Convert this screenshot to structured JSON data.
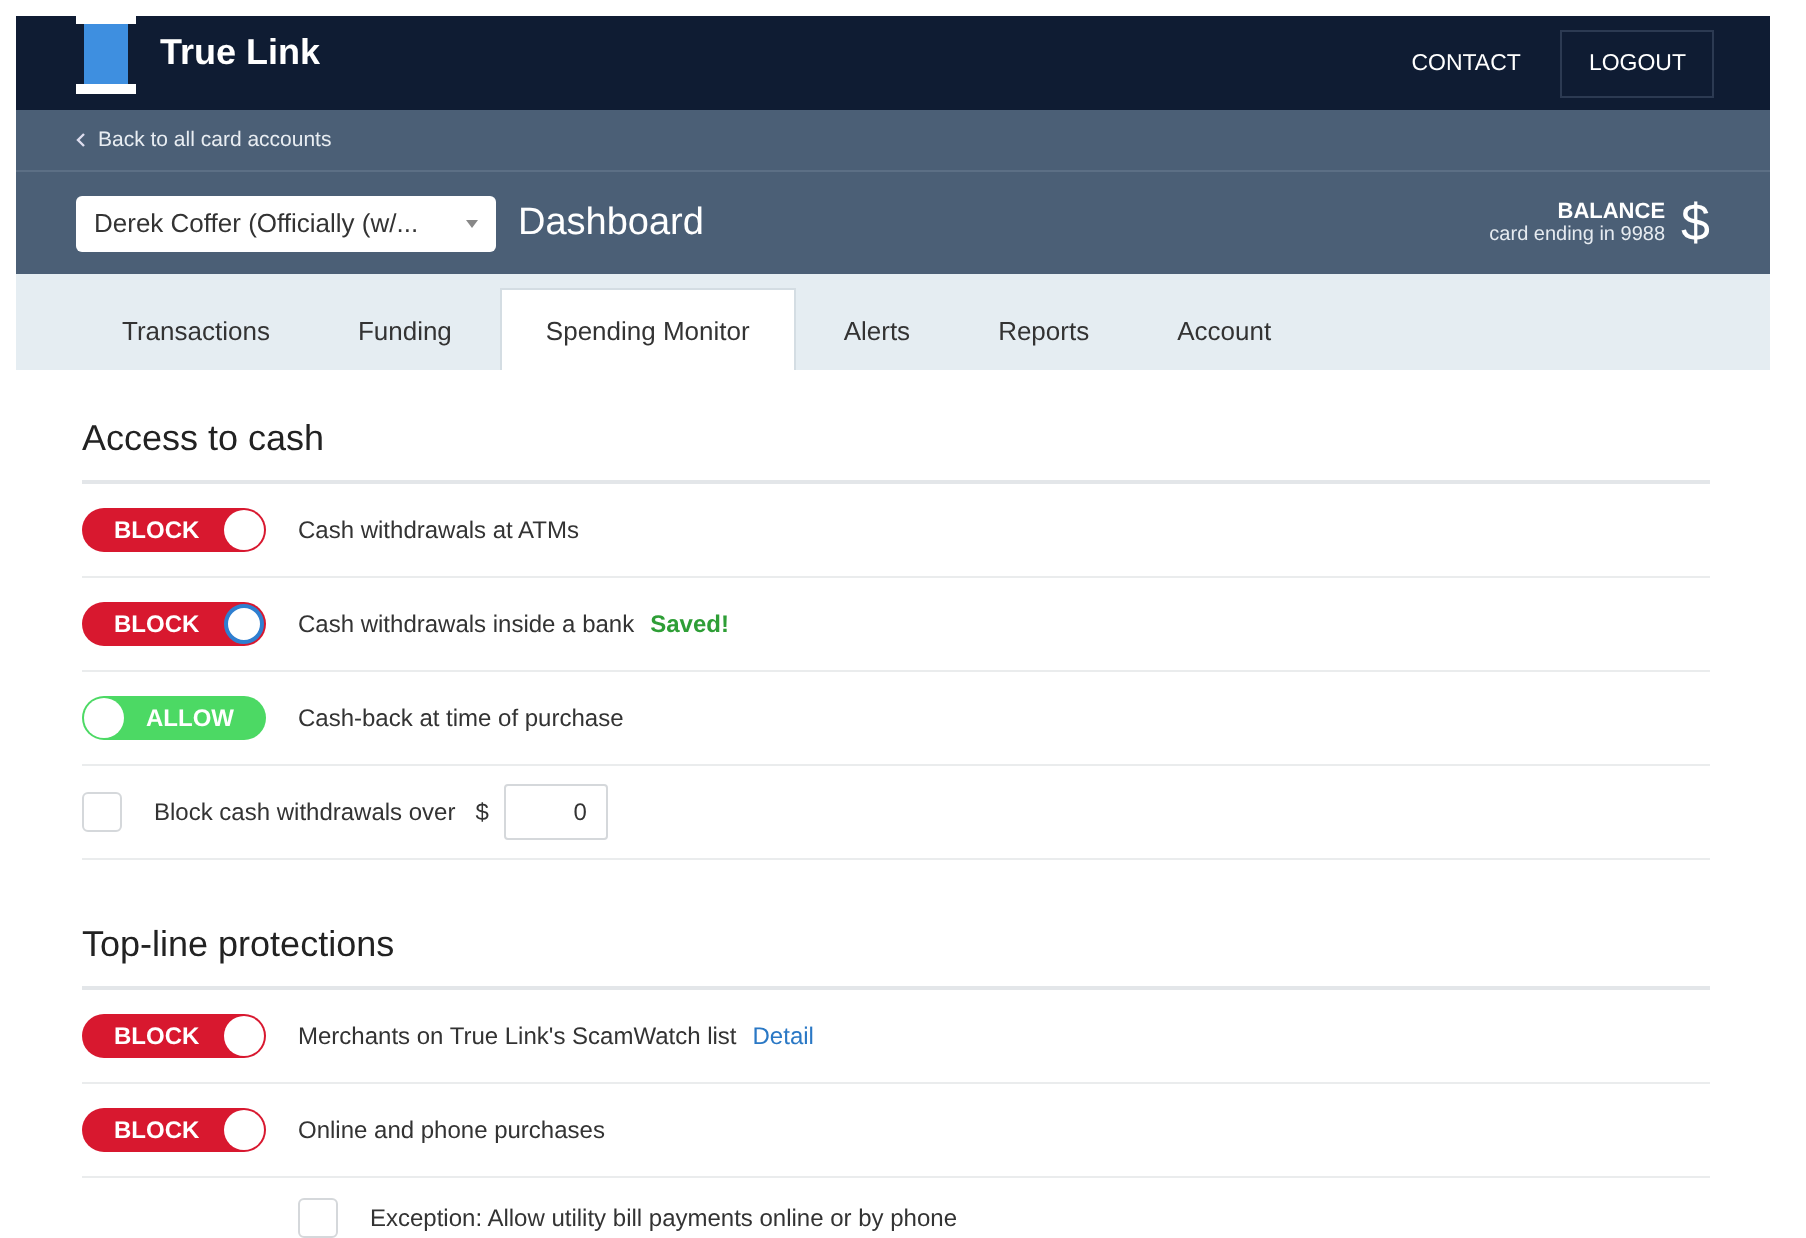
{
  "header": {
    "brand": "True Link",
    "nav": [
      {
        "label": "CONTACT",
        "outlined": false
      },
      {
        "label": "LOGOUT",
        "outlined": true
      }
    ]
  },
  "subheader": {
    "back_link": "Back to all card accounts",
    "account_select": "Derek Coffer (Officially (w/...",
    "page_title": "Dashboard",
    "balance_label": "BALANCE",
    "card_note": "card ending in 9988",
    "currency": "$"
  },
  "tabs": [
    {
      "label": "Transactions",
      "selected": false
    },
    {
      "label": "Funding",
      "selected": false
    },
    {
      "label": "Spending Monitor",
      "selected": true
    },
    {
      "label": "Alerts",
      "selected": false
    },
    {
      "label": "Reports",
      "selected": false
    },
    {
      "label": "Account",
      "selected": false
    }
  ],
  "sections": [
    {
      "title": "Access to cash",
      "rows": [
        {
          "kind": "toggle",
          "state": "BLOCK",
          "blocked": true,
          "focused": false,
          "label": "Cash withdrawals at ATMs"
        },
        {
          "kind": "toggle",
          "state": "BLOCK",
          "blocked": true,
          "focused": true,
          "label": "Cash withdrawals inside a bank",
          "status": "Saved!"
        },
        {
          "kind": "toggle",
          "state": "ALLOW",
          "blocked": false,
          "focused": false,
          "label": "Cash-back at time of purchase"
        },
        {
          "kind": "limit",
          "checked": false,
          "label": "Block cash withdrawals over",
          "currency": "$",
          "value": "0"
        }
      ]
    },
    {
      "title": "Top-line protections",
      "rows": [
        {
          "kind": "toggle",
          "state": "BLOCK",
          "blocked": true,
          "focused": false,
          "label": "Merchants on True Link's ScamWatch list",
          "link": "Detail"
        },
        {
          "kind": "toggle",
          "state": "BLOCK",
          "blocked": true,
          "focused": false,
          "label": "Online and phone purchases"
        },
        {
          "kind": "sub-checkbox",
          "checked": false,
          "label": "Exception: Allow utility bill payments online or by phone"
        }
      ]
    }
  ]
}
